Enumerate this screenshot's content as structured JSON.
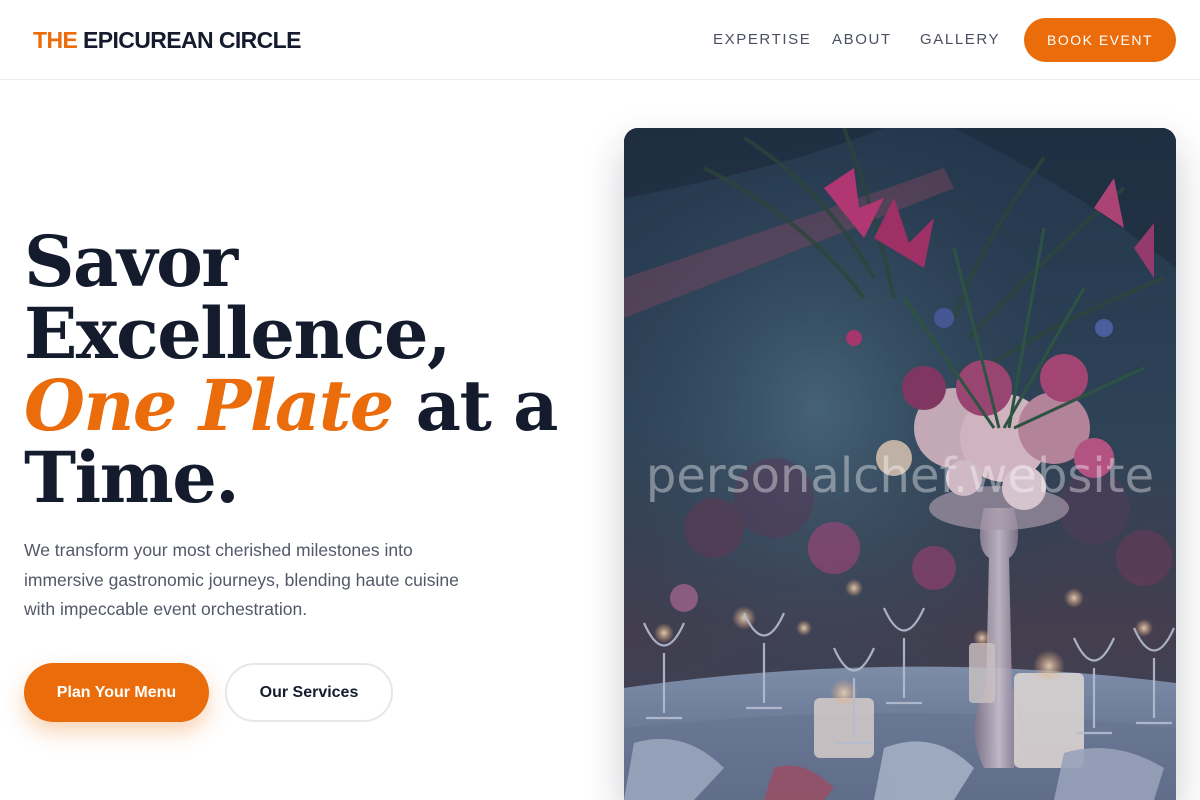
{
  "header": {
    "brand_prefix": "THE",
    "brand_rest": " EPICUREAN CIRCLE",
    "nav": [
      {
        "label": "EXPERTISE"
      },
      {
        "label": "ABOUT"
      },
      {
        "label": "GALLERY"
      }
    ],
    "cta_label": "BOOK EVENT"
  },
  "hero": {
    "headline_line1": "Savor",
    "headline_line2": "Excellence,",
    "headline_emphasis": "One Plate",
    "headline_line3_rest": " at a",
    "headline_line4": "Time.",
    "description": "We transform your most cherished milestones into immersive gastronomic journeys, blending haute cuisine with impeccable event orchestration.",
    "primary_button": "Plan Your Menu",
    "secondary_button": "Our Services",
    "image_watermark": "personalchef.website"
  },
  "colors": {
    "accent": "#ea6c0a",
    "ink": "#141b2d",
    "body_text": "#525868"
  }
}
